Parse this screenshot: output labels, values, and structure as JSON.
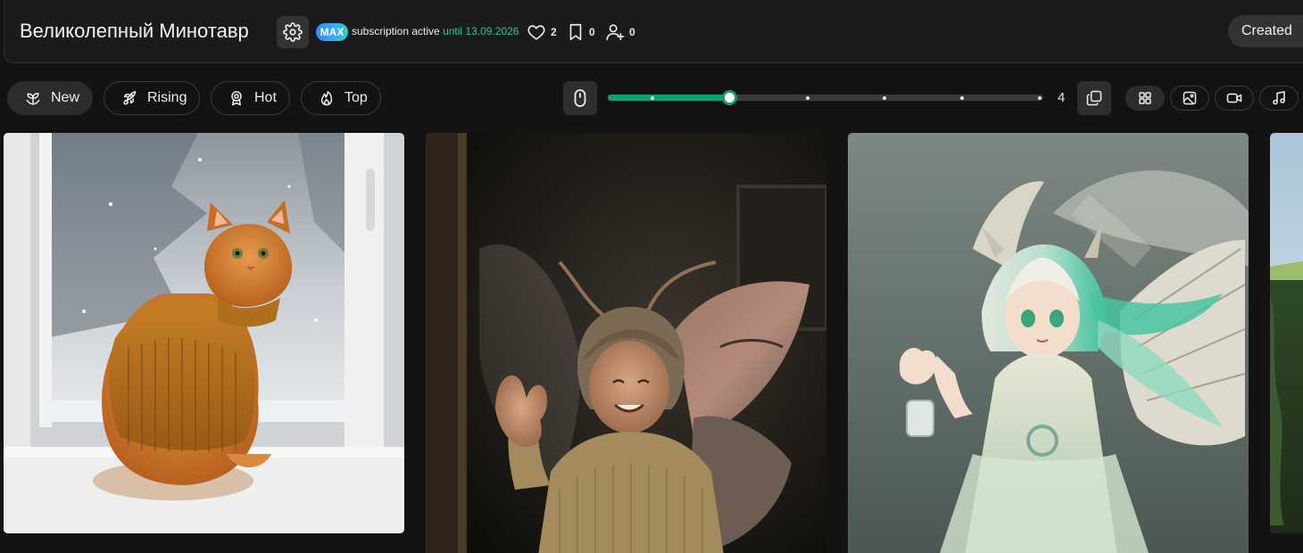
{
  "header": {
    "profile_name": "Великолепный Минотавр",
    "badge": "MAX",
    "subscription_label": "subscription active",
    "subscription_until": "until 13.09.2026",
    "likes_count": "2",
    "saves_count": "0",
    "followers_count": "0",
    "sort_label": "Created"
  },
  "filters": [
    {
      "label": "New",
      "icon": "sprout-icon",
      "active": true
    },
    {
      "label": "Rising",
      "icon": "rocket-icon",
      "active": false
    },
    {
      "label": "Hot",
      "icon": "award-icon",
      "active": false
    },
    {
      "label": "Top",
      "icon": "flame-icon",
      "active": false
    }
  ],
  "grid_slider": {
    "stops": 6,
    "selected_stop": 2,
    "count": "4"
  },
  "media_types": [
    {
      "name": "all",
      "icon": "grid-icon",
      "active": true
    },
    {
      "name": "image",
      "icon": "image-icon",
      "active": false
    },
    {
      "name": "video",
      "icon": "video-icon",
      "active": false
    },
    {
      "name": "audio",
      "icon": "music-note-icon",
      "active": false
    }
  ],
  "colors": {
    "accent": "#10a06c",
    "subscription_green": "#2fc48d",
    "background": "#131313",
    "panel": "#1b1b1b"
  },
  "gallery": [
    {
      "subject": "ginger cat in knitted sweater by snowy window"
    },
    {
      "subject": "smiling moth girl with wings and antennae waving"
    },
    {
      "subject": "anime girl with green hair and dragon wings"
    },
    {
      "subject": "green cliff landscape (cropped)"
    }
  ]
}
